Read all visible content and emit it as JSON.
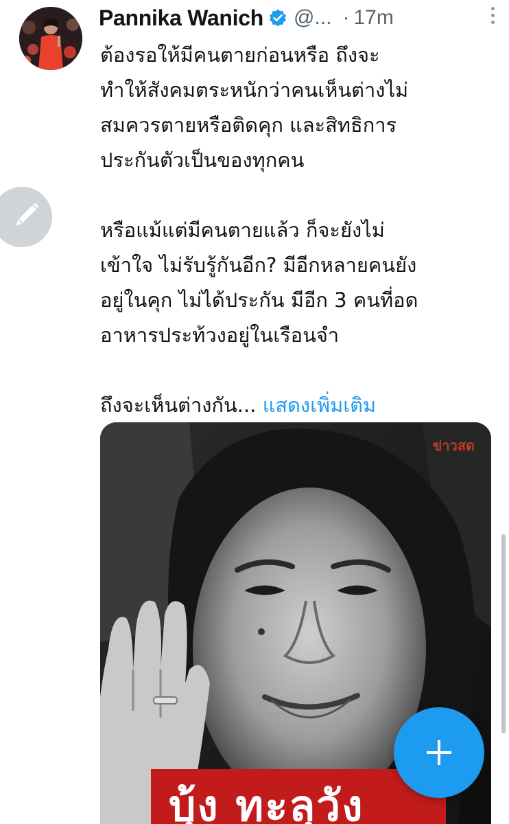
{
  "tweet": {
    "author_name": "Pannika Wanich",
    "handle": "@...",
    "separator": "·",
    "time": "17m",
    "verified": true,
    "body": {
      "para1": [
        "ต้องรอให้มีคนตายก่อนหรือ ถึงจะ",
        "ทำให้สังคมตระหนักว่าคนเห็นต่างไม่",
        "สมควรตายหรือติดคุก และสิทธิการ",
        "ประกันตัวเป็นของทุกคน"
      ],
      "para2": [
        "หรือแม้แต่มีคนตายแล้ว ก็จะยังไม่",
        "เข้าใจ ไม่รับรู้กันอีก? มีอีกหลายคนยัง",
        "อยู่ในคุก ไม่ได้ประกัน มีอีก 3 คนที่อด",
        "อาหารประท้วงอยู่ในเรือนจำ"
      ],
      "para3_text": "ถึงจะเห็นต่างกัน...",
      "show_more": "แสดงเพิ่มเติม"
    },
    "media": {
      "watermark": "ข่าวสด",
      "caption": "บุ้ง ทะลุวัง"
    }
  },
  "icons": {
    "avatar": "avatar",
    "verified": "verified-badge-icon",
    "more": "more-vertical-icon",
    "edit": "pencil-icon",
    "compose": "plus-icon"
  },
  "colors": {
    "accent": "#1d9bf0",
    "text": "#0f1419",
    "muted": "#536471",
    "banner": "#c21b1b"
  }
}
